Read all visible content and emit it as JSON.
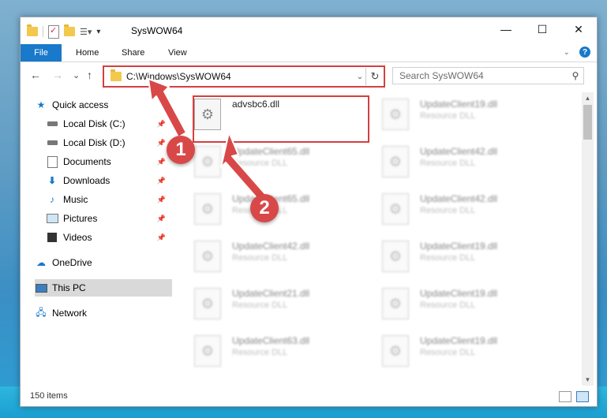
{
  "window": {
    "title": "SysWOW64"
  },
  "window_buttons": {
    "minimize": "—",
    "maximize": "☐",
    "close": "✕"
  },
  "ribbon": {
    "file": "File",
    "home": "Home",
    "share": "Share",
    "view": "View"
  },
  "nav": {
    "back": "←",
    "forward": "→",
    "recent": "⌄",
    "up": "↑"
  },
  "address": {
    "path": "C:\\Windows\\SysWOW64"
  },
  "search": {
    "placeholder": "Search SysWOW64"
  },
  "sidebar": {
    "items": [
      {
        "label": "Quick access",
        "icon": "star-icon"
      },
      {
        "label": "Local Disk (C:)",
        "icon": "drive-icon"
      },
      {
        "label": "Local Disk (D:)",
        "icon": "drive-icon"
      },
      {
        "label": "Documents",
        "icon": "documents-icon"
      },
      {
        "label": "Downloads",
        "icon": "downloads-icon"
      },
      {
        "label": "Music",
        "icon": "music-icon"
      },
      {
        "label": "Pictures",
        "icon": "pictures-icon"
      },
      {
        "label": "Videos",
        "icon": "videos-icon"
      },
      {
        "label": "OneDrive",
        "icon": "cloud-icon"
      },
      {
        "label": "This PC",
        "icon": "computer-icon"
      },
      {
        "label": "Network",
        "icon": "network-icon"
      }
    ]
  },
  "files": {
    "col1": [
      {
        "name": "advsbc6.dll",
        "type": ""
      },
      {
        "name": "UpdateClient65.dll",
        "type": "Resource DLL"
      },
      {
        "name": "UpdateClient65.dll",
        "type": "Resource DLL"
      },
      {
        "name": "UpdateClient42.dll",
        "type": "Resource DLL"
      },
      {
        "name": "UpdateClient21.dll",
        "type": "Resource DLL"
      },
      {
        "name": "UpdateClient63.dll",
        "type": "Resource DLL"
      }
    ],
    "col2": [
      {
        "name": "UpdateClient19.dll",
        "type": "Resource DLL"
      },
      {
        "name": "UpdateClient42.dll",
        "type": "Resource DLL"
      },
      {
        "name": "UpdateClient42.dll",
        "type": "Resource DLL"
      },
      {
        "name": "UpdateClient19.dll",
        "type": "Resource DLL"
      },
      {
        "name": "UpdateClient19.dll",
        "type": "Resource DLL"
      },
      {
        "name": "UpdateClient19.dll",
        "type": "Resource DLL"
      }
    ]
  },
  "status": {
    "items": "150 items"
  },
  "callouts": {
    "one": "1",
    "two": "2"
  },
  "colors": {
    "accent": "#1979ca",
    "highlight": "#d53f3f",
    "callout": "#d94848"
  }
}
